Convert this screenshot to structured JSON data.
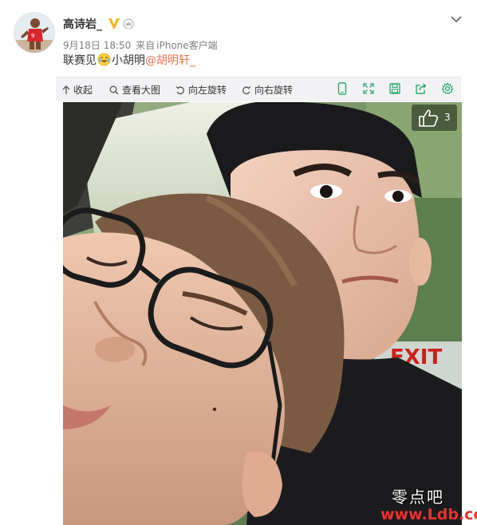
{
  "post": {
    "username": "高诗岩_",
    "date": "9月18日 18:50",
    "source_prefix": "来自",
    "source": "iPhone客户端",
    "text_part1": "联赛见",
    "text_part2": "小胡明",
    "mention": "@胡明轩_"
  },
  "toolbar": {
    "collapse": "收起",
    "view_large": "查看大图",
    "rotate_left": "向左旋转",
    "rotate_right": "向右旋转"
  },
  "photo": {
    "like_count": "3",
    "sign_text": "EXIT"
  },
  "watermark": {
    "site_name": "零点吧",
    "site_url": "www.Ldb.cc"
  },
  "colors": {
    "mention": "#eb7350",
    "meta_gray": "#808080",
    "toolbar_bg": "#f2f2f5",
    "icon_green": "#2fa96d",
    "vip_gold": "#f7b72e"
  }
}
